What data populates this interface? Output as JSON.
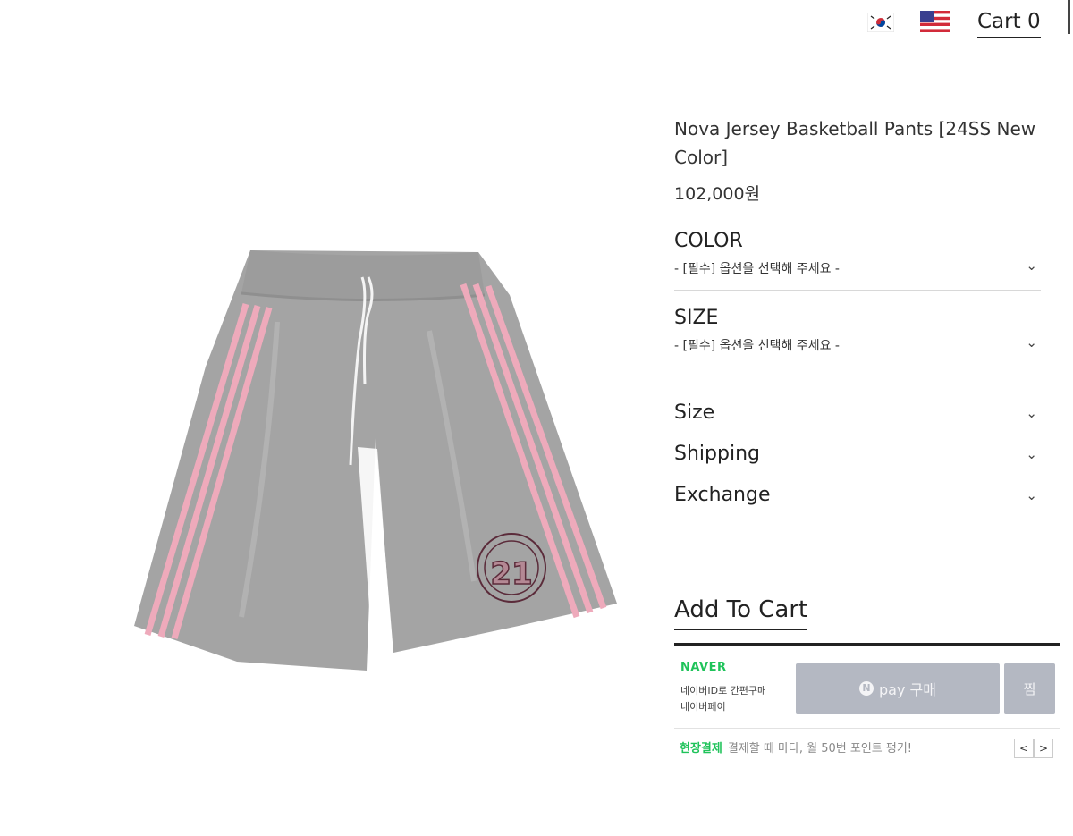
{
  "header": {
    "lang_kr_icon": "korea-flag-icon",
    "lang_en_icon": "usa-flag-icon",
    "cart_label": "Cart 0"
  },
  "product": {
    "title": "Nova Jersey Basketball Pants [24SS New Color]",
    "price": "102,000원",
    "colors": {
      "body": "#a4a4a4",
      "stripe": "#eeaabb",
      "logo": "#5b2b3a"
    },
    "graphic_number": "21"
  },
  "options": [
    {
      "label": "COLOR",
      "value": "- [필수] 옵션을 선택해 주세요 -"
    },
    {
      "label": "SIZE",
      "value": "- [필수] 옵션을 선택해 주세요 -"
    }
  ],
  "accordion": [
    {
      "label": "Size"
    },
    {
      "label": "Shipping"
    },
    {
      "label": "Exchange"
    }
  ],
  "add_to_cart": "Add To Cart",
  "naver": {
    "logo": "NAVER",
    "line1": "네이버ID로 간편구매",
    "line2": "네이버페이",
    "pay_icon": "N",
    "pay_label": "pay 구매",
    "wish_label": "찜",
    "promo_strong": "현장결제",
    "promo_text": "결제할 때 마다, 월 50번 포인트 펑기!",
    "prev": "<",
    "next": ">"
  }
}
